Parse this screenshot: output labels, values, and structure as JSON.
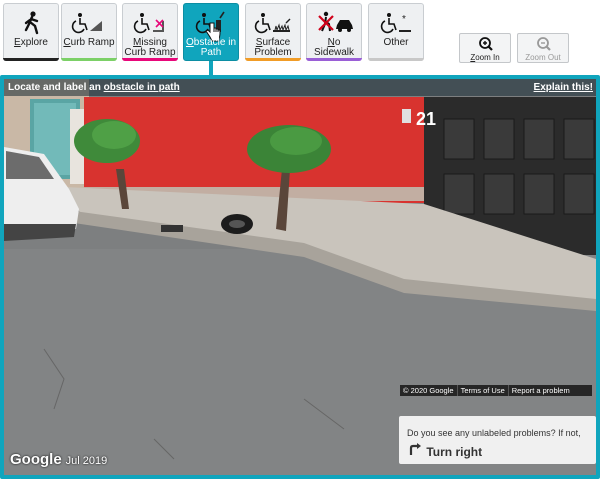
{
  "toolbar": {
    "tools": [
      {
        "label_parts": [
          "E",
          "xplore"
        ],
        "underline_first": true,
        "bar_color": "#222222",
        "icon": "walking-person-icon"
      },
      {
        "label_parts": [
          "C",
          "urb Ramp"
        ],
        "underline_first": true,
        "bar_color": "#7cd067",
        "icon": "curb-ramp-icon"
      },
      {
        "label_parts": [
          "M",
          "issing",
          "Curb Ramp"
        ],
        "underline_first": true,
        "bar_color": "#e8087a",
        "icon": "missing-curb-ramp-icon"
      },
      {
        "label_parts": [
          "O",
          "bstacle in",
          "Path"
        ],
        "underline_first": true,
        "bar_color": "#10a5bd",
        "icon": "obstacle-in-path-icon"
      },
      {
        "label_parts": [
          "S",
          "urface",
          "Problem"
        ],
        "underline_first": true,
        "bar_color": "#f19c26",
        "icon": "surface-problem-icon"
      },
      {
        "label_parts": [
          "N",
          "o Sidewalk"
        ],
        "underline_first": true,
        "bar_color": "#9a5fd6",
        "icon": "no-sidewalk-icon"
      },
      {
        "label_parts": [
          "",
          "Other"
        ],
        "underline_first": false,
        "bar_color": "#c8c8c8",
        "icon": "other-icon"
      }
    ],
    "zoom_in": {
      "label_parts": [
        "Z",
        "oom In"
      ]
    },
    "zoom_out": {
      "label_parts": [
        "",
        "Zoom Out"
      ]
    }
  },
  "pano": {
    "instruction_prefix": "Locate and label an ",
    "instruction_link": "obstacle in path",
    "explain": "Explain this!",
    "house_number": "21",
    "google_logo": "Google",
    "capture_date": "Jul 2019"
  },
  "prompt": {
    "question": "Do you see any unlabeled problems? If not,",
    "action": "Turn right"
  },
  "footer": {
    "copyright": "© 2020 Google",
    "terms": "Terms of Use",
    "report": "Report a problem"
  },
  "colors": {
    "accent": "#10a5bd",
    "wall_red": "#d8332f"
  }
}
